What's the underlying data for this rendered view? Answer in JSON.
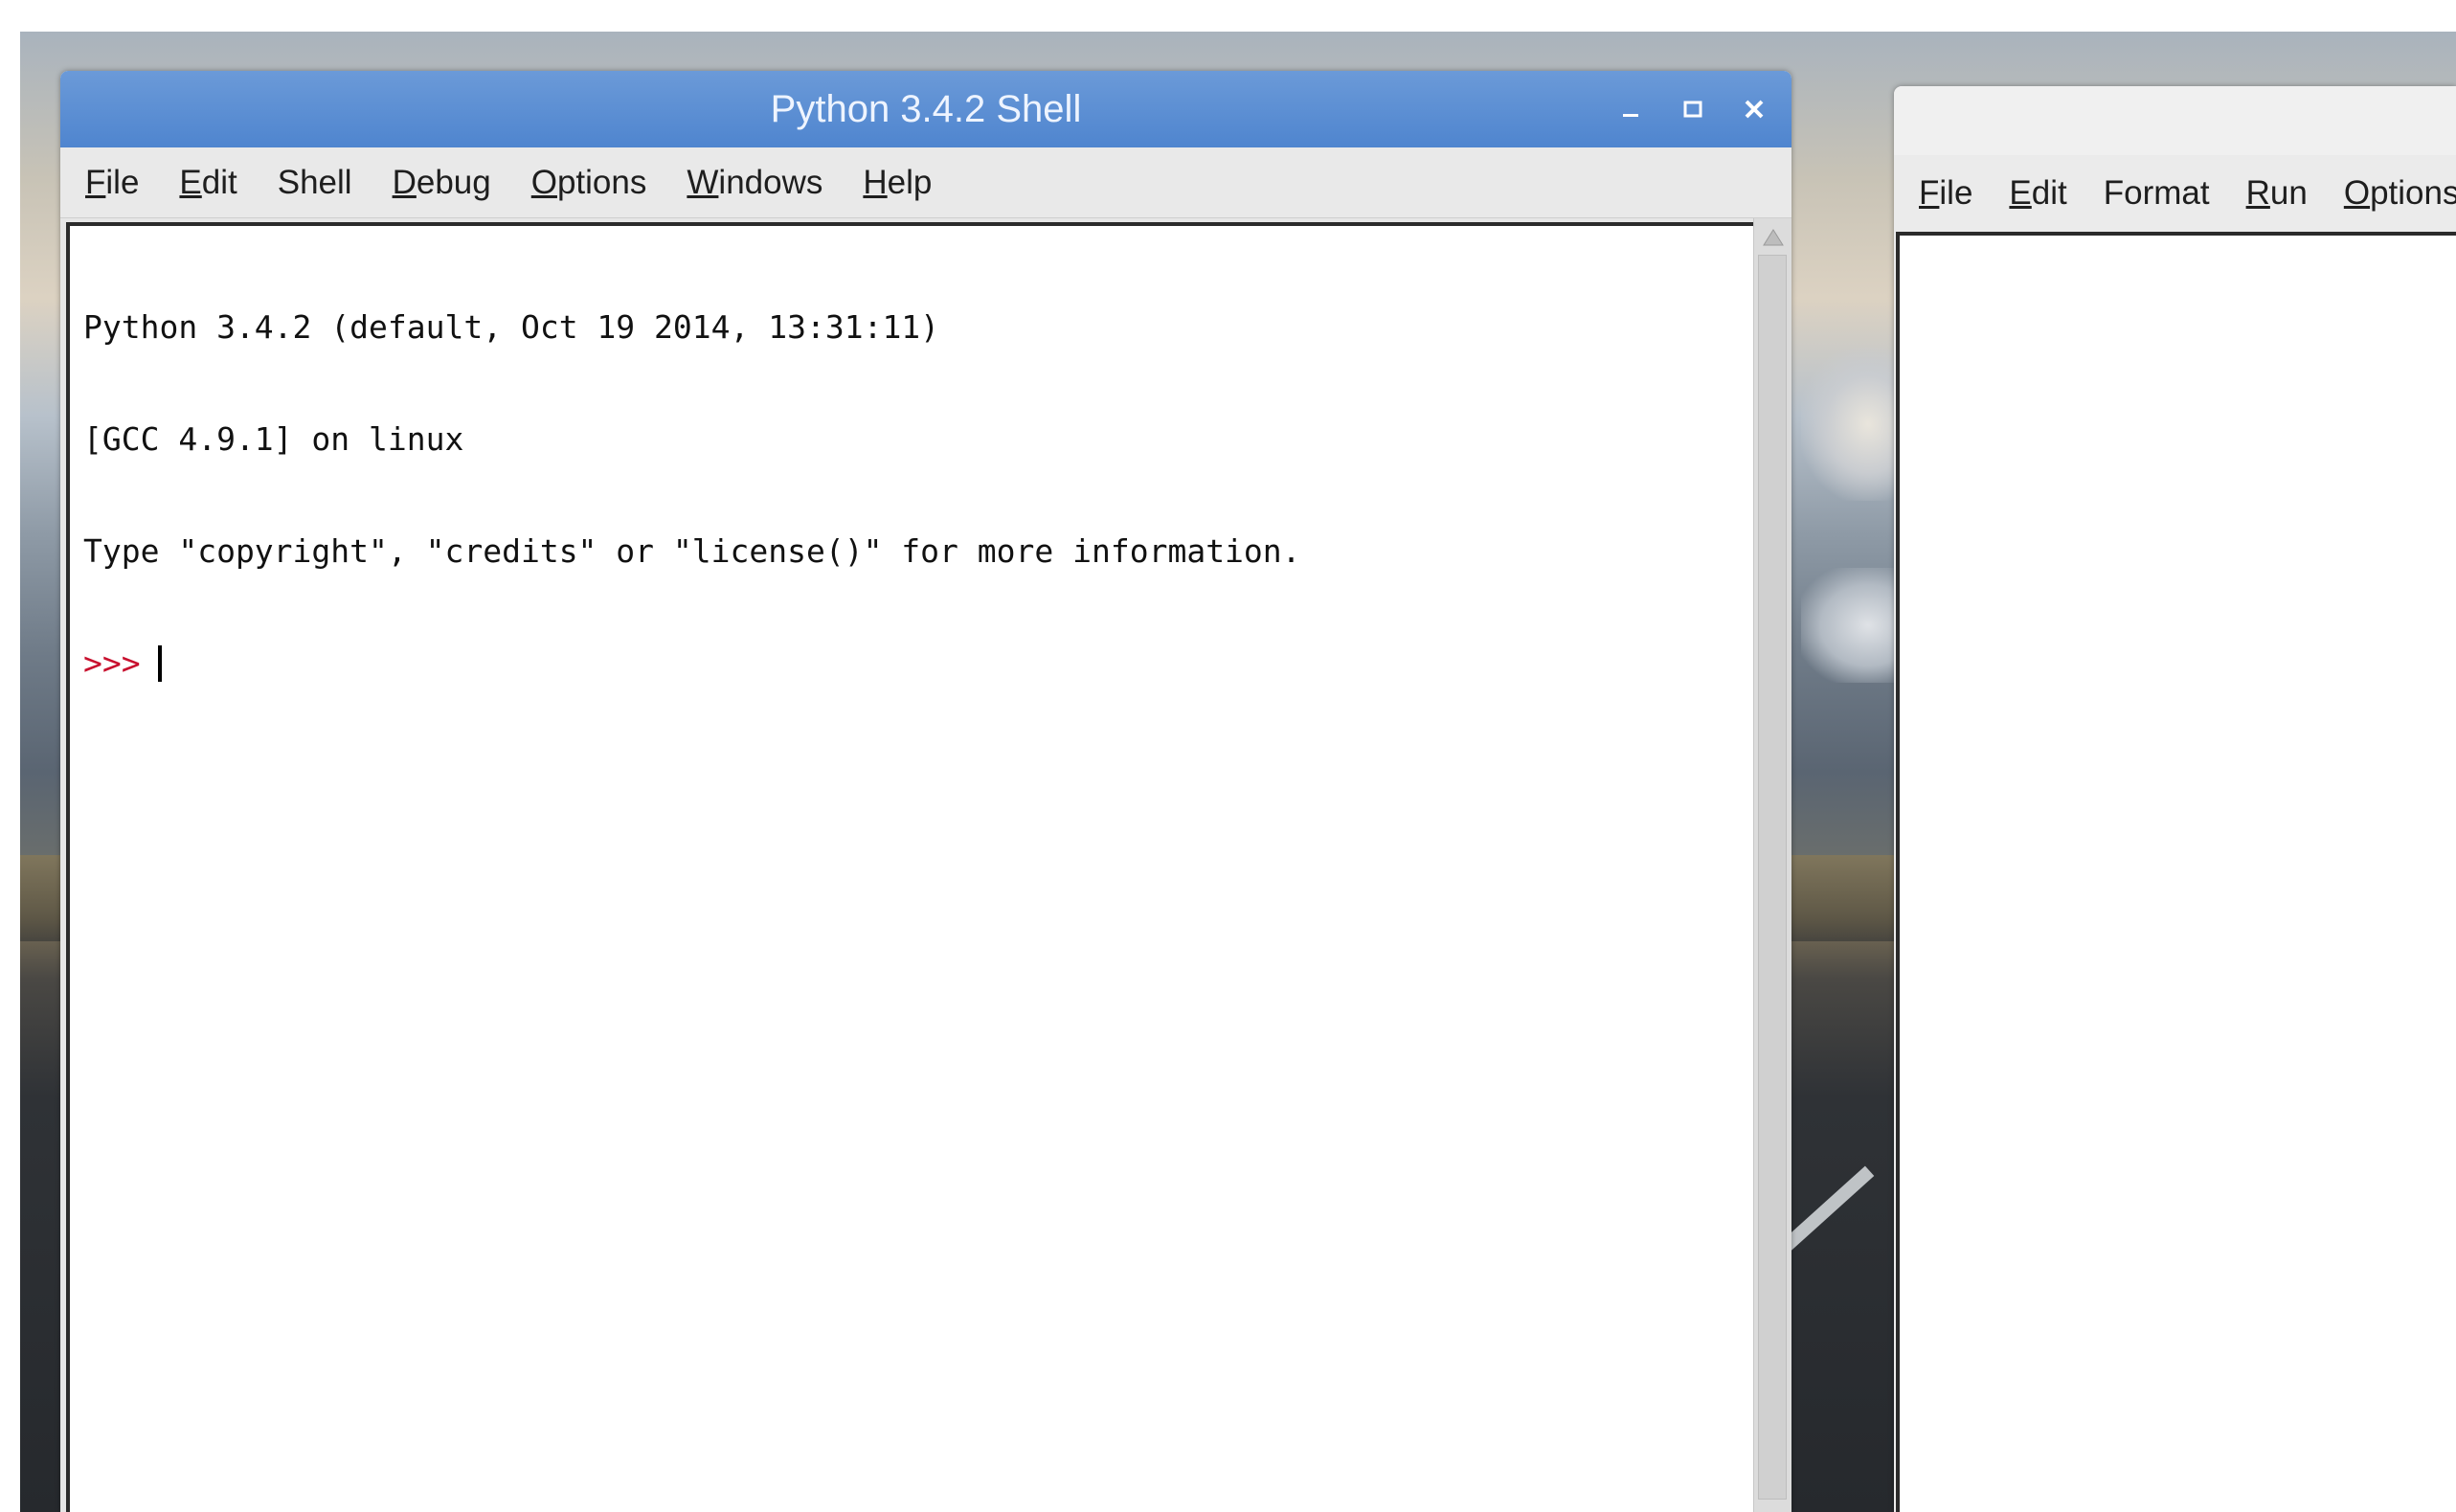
{
  "shell_window": {
    "title": "Python 3.4.2 Shell",
    "controls": {
      "minimize_icon": "minimize-icon",
      "maximize_icon": "maximize-icon",
      "close_icon": "close-icon"
    },
    "menu": [
      {
        "label": "File",
        "mnemonic": "F",
        "rest": "ile"
      },
      {
        "label": "Edit",
        "mnemonic": "E",
        "rest": "dit"
      },
      {
        "label": "Shell",
        "mnemonic": "",
        "rest": "Shell"
      },
      {
        "label": "Debug",
        "mnemonic": "D",
        "rest": "ebug"
      },
      {
        "label": "Options",
        "mnemonic": "O",
        "rest": "ptions"
      },
      {
        "label": "Windows",
        "mnemonic": "W",
        "rest": "indows"
      },
      {
        "label": "Help",
        "mnemonic": "H",
        "rest": "elp"
      }
    ],
    "console": {
      "lines": [
        "Python 3.4.2 (default, Oct 19 2014, 13:31:11)",
        "[GCC 4.9.1] on linux",
        "Type \"copyright\", \"credits\" or \"license()\" for more information."
      ],
      "prompt": ">>>"
    }
  },
  "editor_window": {
    "menu": [
      {
        "label": "File",
        "mnemonic": "F",
        "rest": "ile"
      },
      {
        "label": "Edit",
        "mnemonic": "E",
        "rest": "dit"
      },
      {
        "label": "Format",
        "mnemonic": "",
        "rest": "Format"
      },
      {
        "label": "Run",
        "mnemonic": "R",
        "rest": "un"
      },
      {
        "label": "Options",
        "mnemonic": "O",
        "rest": "ptions"
      }
    ]
  },
  "colors": {
    "titlebar": "#4f85cf",
    "prompt": "#c8102e",
    "menubar": "#e9e9e9"
  }
}
